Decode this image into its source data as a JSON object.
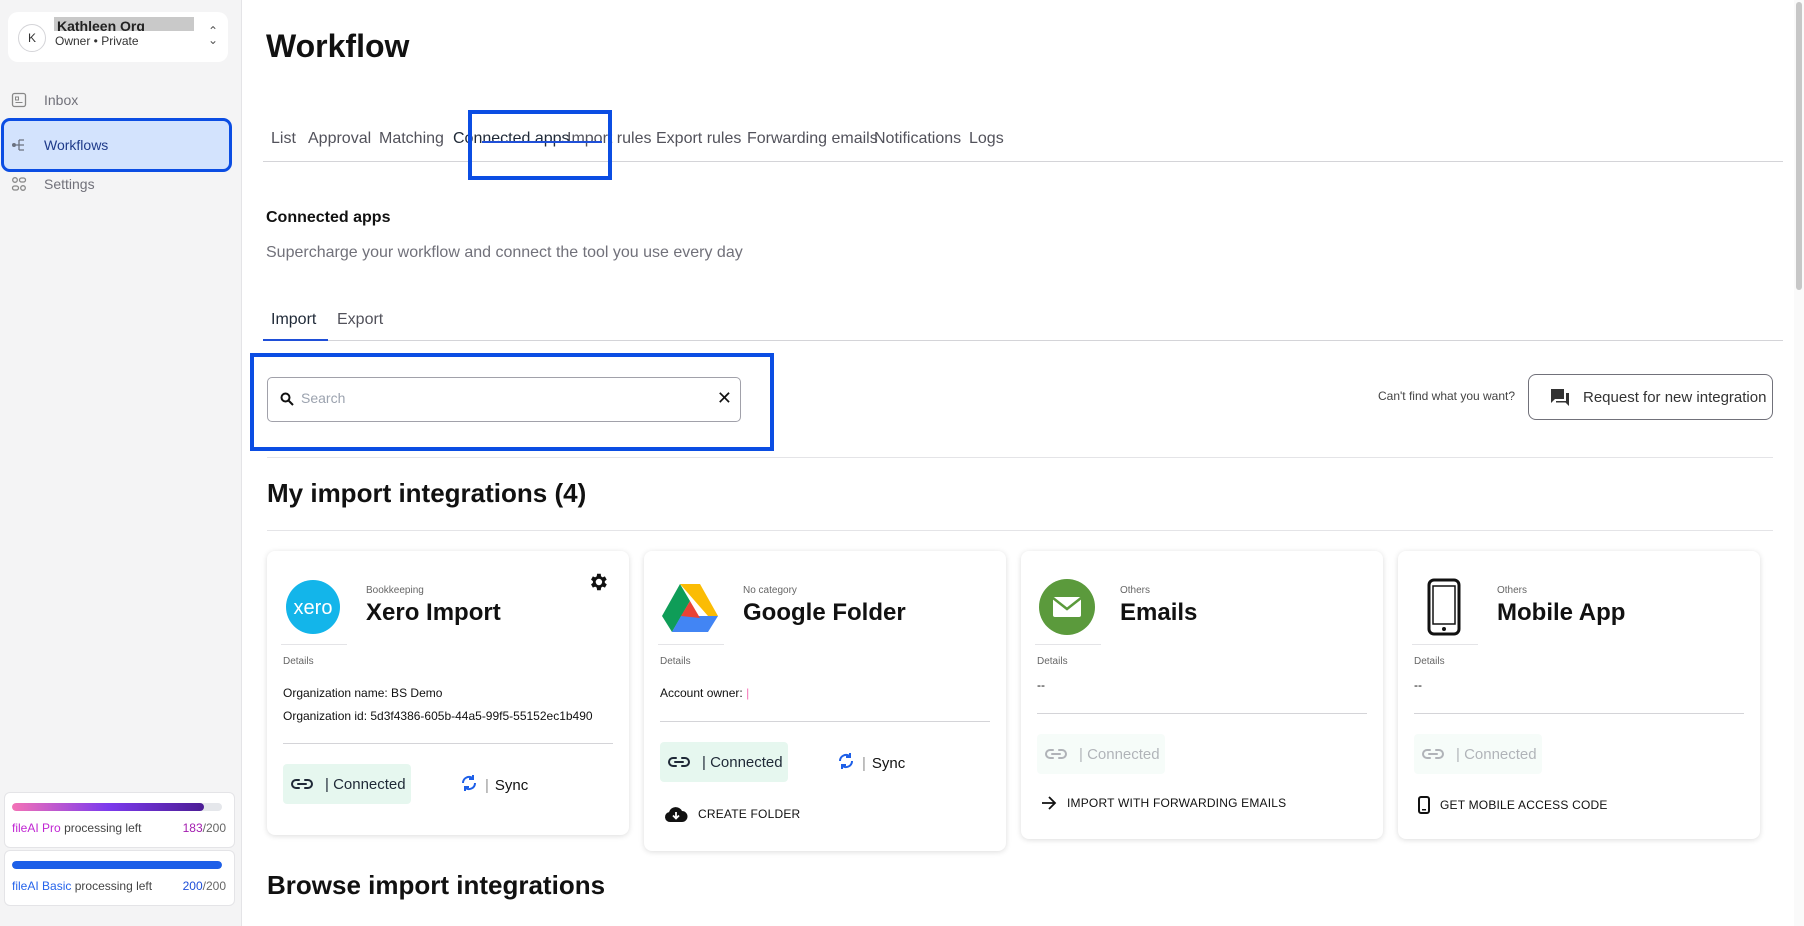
{
  "org": {
    "avatar_letter": "K",
    "name": "Kathleen Org [DEMO]",
    "subtitle": "Owner • Private"
  },
  "sidebar": {
    "items": [
      {
        "label": "Inbox",
        "icon": "inbox-icon"
      },
      {
        "label": "Workflows",
        "icon": "workflow-icon",
        "active": true
      },
      {
        "label": "Settings",
        "icon": "settings-icon"
      }
    ]
  },
  "quota": [
    {
      "brand": "fileAI",
      "plan": "Pro",
      "text": "processing left",
      "used": "183",
      "total": "/200",
      "fraction": 0.915,
      "color": "#a855f7"
    },
    {
      "brand": "fileAI",
      "plan": "Basic",
      "text": "processing left",
      "used": "200",
      "total": "/200",
      "fraction": 1.0,
      "color": "#2563eb"
    }
  ],
  "page": {
    "title": "Workflow"
  },
  "tabs": [
    "List",
    "Approval",
    "Matching",
    "Connected apps",
    "Import rules",
    "Export rules",
    "Forwarding emails",
    "Notifications",
    "Logs"
  ],
  "active_tab": "Connected apps",
  "section": {
    "title": "Connected apps",
    "subtitle": "Supercharge your workflow and connect the tool you use every day"
  },
  "subtabs": [
    "Import",
    "Export"
  ],
  "active_subtab": "Import",
  "search": {
    "placeholder": "Search",
    "value": ""
  },
  "request": {
    "hint": "Can't find what you want?",
    "button": "Request for new integration"
  },
  "my_integrations": {
    "title": "My import integrations (4)",
    "cards": [
      {
        "category": "Bookkeeping",
        "name": "Xero Import",
        "icon": "xero-logo",
        "details_label": "Details",
        "details": [
          "Organization name: BS Demo",
          "Organization id: 5d3f4386-605b-44a5-99f5-55152ec1b490"
        ],
        "status": "| Connected",
        "sync": "Sync",
        "settings_icon": "gear-icon"
      },
      {
        "category": "No category",
        "name": "Google Folder",
        "icon": "google-drive-logo",
        "details_label": "Details",
        "details": [
          "Account owner:"
        ],
        "status": "| Connected",
        "sync": "Sync",
        "action": "CREATE FOLDER",
        "action_icon": "cloud-download-icon"
      },
      {
        "category": "Others",
        "name": "Emails",
        "icon": "email-logo",
        "details_label": "Details",
        "details": [
          "--"
        ],
        "status": "| Connected",
        "action": "IMPORT WITH FORWARDING EMAILS",
        "action_icon": "arrow-right-icon"
      },
      {
        "category": "Others",
        "name": "Mobile App",
        "icon": "phone-logo",
        "details_label": "Details",
        "details": [
          "--"
        ],
        "status": "| Connected",
        "action": "GET MOBILE ACCESS CODE",
        "action_icon": "phone-icon"
      }
    ]
  },
  "browse": {
    "title": "Browse import integrations"
  },
  "colors": {
    "accent": "#0b4de3",
    "active_nav_bg": "#d3e3fd",
    "connected_bg": "#e6f7ef",
    "xero": "#13b5ea",
    "email_green": "#5b9a3c"
  }
}
